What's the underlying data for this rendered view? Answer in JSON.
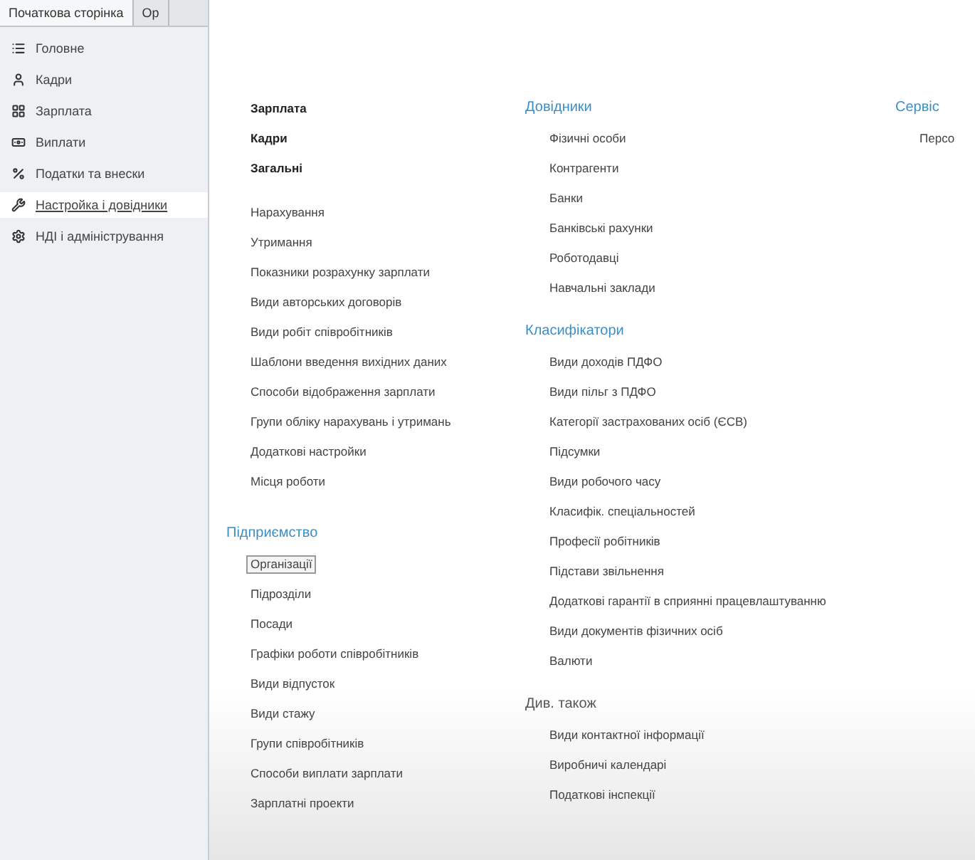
{
  "tabs": [
    {
      "label": "Початкова сторінка",
      "selected": true
    },
    {
      "label": "Ор",
      "selected": false
    }
  ],
  "sidebar": {
    "items": [
      {
        "label": "Головне",
        "selected": false
      },
      {
        "label": "Кадри",
        "selected": false
      },
      {
        "label": "Зарплата",
        "selected": false
      },
      {
        "label": "Виплати",
        "selected": false
      },
      {
        "label": "Податки та внески",
        "selected": false
      },
      {
        "label": "Настройка і довідники",
        "selected": true
      },
      {
        "label": "НДІ і адміністрування",
        "selected": false
      }
    ]
  },
  "columns": [
    {
      "sections": [
        {
          "kind": "strong",
          "items": [
            {
              "label": "Зарплата",
              "focused": false
            },
            {
              "label": "Кадри",
              "focused": false
            },
            {
              "label": "Загальні",
              "focused": false
            }
          ]
        },
        {
          "kind": "plain",
          "items": [
            {
              "label": "Нарахування",
              "focused": false
            },
            {
              "label": "Утримання",
              "focused": false
            },
            {
              "label": "Показники розрахунку зарплати",
              "focused": false
            },
            {
              "label": "Види авторських договорів",
              "focused": false
            },
            {
              "label": "Види робіт співробітників",
              "focused": false
            },
            {
              "label": "Шаблони введення вихідних даних",
              "focused": false
            },
            {
              "label": "Способи відображення зарплати",
              "focused": false
            },
            {
              "label": "Групи обліку нарахувань і утримань",
              "focused": false
            },
            {
              "label": "Додаткові настройки",
              "focused": false
            },
            {
              "label": "Місця роботи",
              "focused": false
            }
          ]
        },
        {
          "kind": "group",
          "title": "Підприємство",
          "items": [
            {
              "label": "Організації",
              "focused": true
            },
            {
              "label": "Підрозділи",
              "focused": false
            },
            {
              "label": "Посади",
              "focused": false
            },
            {
              "label": "Графіки роботи співробітників",
              "focused": false
            },
            {
              "label": "Види відпусток",
              "focused": false
            },
            {
              "label": "Види стажу",
              "focused": false
            },
            {
              "label": "Групи співробітників",
              "focused": false
            },
            {
              "label": "Способи виплати зарплати",
              "focused": false
            },
            {
              "label": "Зарплатні проекти",
              "focused": false
            }
          ]
        }
      ]
    },
    {
      "sections": [
        {
          "kind": "group",
          "title": "Довідники",
          "items": [
            {
              "label": "Фізичні особи",
              "focused": false
            },
            {
              "label": "Контрагенти",
              "focused": false
            },
            {
              "label": "Банки",
              "focused": false
            },
            {
              "label": "Банківські рахунки",
              "focused": false
            },
            {
              "label": "Роботодавці",
              "focused": false
            },
            {
              "label": "Навчальні заклади",
              "focused": false
            }
          ]
        },
        {
          "kind": "group",
          "title": "Класифікатори",
          "items": [
            {
              "label": "Види доходів ПДФО",
              "focused": false
            },
            {
              "label": "Види пільг з ПДФО",
              "focused": false
            },
            {
              "label": "Категорії застрахованих осіб (ЄСВ)",
              "focused": false
            },
            {
              "label": "Підсумки",
              "focused": false
            },
            {
              "label": "Види робочого часу",
              "focused": false
            },
            {
              "label": "Класифік. спеціальностей",
              "focused": false
            },
            {
              "label": "Професії робітників",
              "focused": false
            },
            {
              "label": "Підстави звільнення",
              "focused": false
            },
            {
              "label": "Додаткові гарантії в сприянні працевлаштуванню",
              "focused": false
            },
            {
              "label": "Види документів фізичних осіб",
              "focused": false
            },
            {
              "label": "Валюти",
              "focused": false
            }
          ]
        },
        {
          "kind": "see_also",
          "title": "Див. також",
          "items": [
            {
              "label": "Види контактної інформації",
              "focused": false
            },
            {
              "label": "Виробничі календарі",
              "focused": false
            },
            {
              "label": "Податкові інспекції",
              "focused": false
            }
          ]
        }
      ]
    },
    {
      "sections": [
        {
          "kind": "group",
          "title": "Сервіс",
          "items": [
            {
              "label": "Персо",
              "focused": false
            }
          ]
        }
      ]
    }
  ]
}
